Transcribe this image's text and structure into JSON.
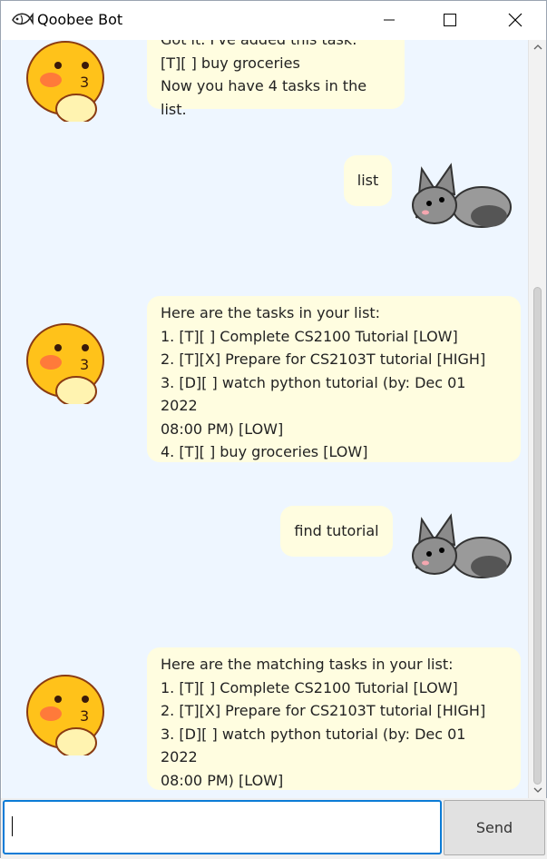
{
  "window": {
    "title": "Qoobee Bot"
  },
  "messages": [
    {
      "sender": "bot",
      "text": "Got it. I've added this task:\n[T][ ] buy groceries\nNow you have 4 tasks in the list."
    },
    {
      "sender": "user",
      "text": "list"
    },
    {
      "sender": "bot",
      "text": "Here are the tasks in your list:\n1. [T][ ] Complete CS2100 Tutorial [LOW]\n2. [T][X] Prepare for CS2103T tutorial [HIGH]\n3. [D][ ] watch python tutorial (by: Dec 01 2022\n08:00 PM) [LOW]\n4. [T][ ] buy groceries [LOW]"
    },
    {
      "sender": "user",
      "text": "find tutorial"
    },
    {
      "sender": "bot",
      "text": "Here are the matching tasks in your list:\n1. [T][ ] Complete CS2100 Tutorial [LOW]\n2. [T][X] Prepare for CS2103T tutorial [HIGH]\n3. [D][ ] watch python tutorial (by: Dec 01 2022\n08:00 PM) [LOW]"
    }
  ],
  "input": {
    "value": "",
    "placeholder": ""
  },
  "send_label": "Send",
  "colors": {
    "chat_bg": "#eef6ff",
    "bubble": "#fffde0",
    "accent": "#0b7bd6"
  }
}
